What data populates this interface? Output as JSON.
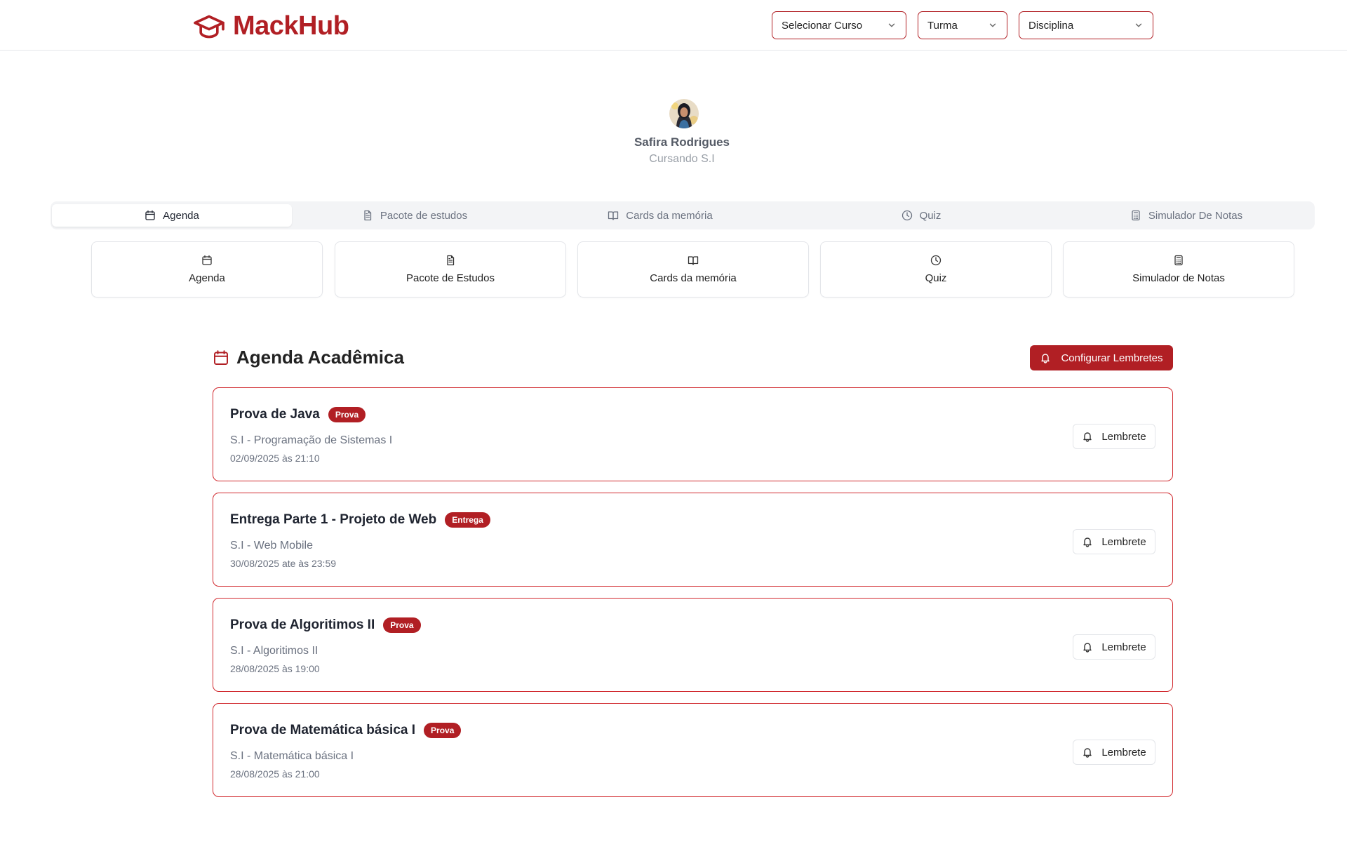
{
  "brand": {
    "name": "MackHub",
    "color": "#b11f24",
    "icon": "graduation-cap-icon"
  },
  "filters": {
    "curso": "Selecionar Curso",
    "turma": "Turma",
    "disciplina": "Disciplina"
  },
  "profile": {
    "name": "Safira Rodrigues",
    "subtitle": "Cursando S.I"
  },
  "tabs": [
    {
      "label": "Agenda",
      "icon": "calendar-icon",
      "active": true
    },
    {
      "label": "Pacote de estudos",
      "icon": "document-icon",
      "active": false
    },
    {
      "label": "Cards da memória",
      "icon": "book-open-icon",
      "active": false
    },
    {
      "label": "Quiz",
      "icon": "clock-icon",
      "active": false
    },
    {
      "label": "Simulador De Notas",
      "icon": "calculator-icon",
      "active": false
    }
  ],
  "feature_cards": [
    {
      "label": "Agenda",
      "icon": "calendar-icon"
    },
    {
      "label": "Pacote de Estudos",
      "icon": "document-icon"
    },
    {
      "label": "Cards da memória",
      "icon": "book-open-icon"
    },
    {
      "label": "Quiz",
      "icon": "clock-icon"
    },
    {
      "label": "Simulador de Notas",
      "icon": "calculator-icon"
    }
  ],
  "agenda": {
    "title": "Agenda Acadêmica",
    "config_button": "Configurar Lembretes",
    "reminder_label": "Lembrete",
    "events": [
      {
        "title": "Prova de Java",
        "badge": "Prova",
        "subtitle": "S.I - Programação de Sistemas I",
        "date": "02/09/2025 às 21:10"
      },
      {
        "title": "Entrega Parte 1 - Projeto de Web",
        "badge": "Entrega",
        "subtitle": "S.I - Web Mobile",
        "date": "30/08/2025 ate às 23:59"
      },
      {
        "title": "Prova de Algoritimos II",
        "badge": "Prova",
        "subtitle": "S.I - Algoritimos II",
        "date": "28/08/2025 às 19:00"
      },
      {
        "title": "Prova de Matemática básica I",
        "badge": "Prova",
        "subtitle": "S.I - Matemática básica I",
        "date": "28/08/2025 às 21:00"
      }
    ]
  }
}
